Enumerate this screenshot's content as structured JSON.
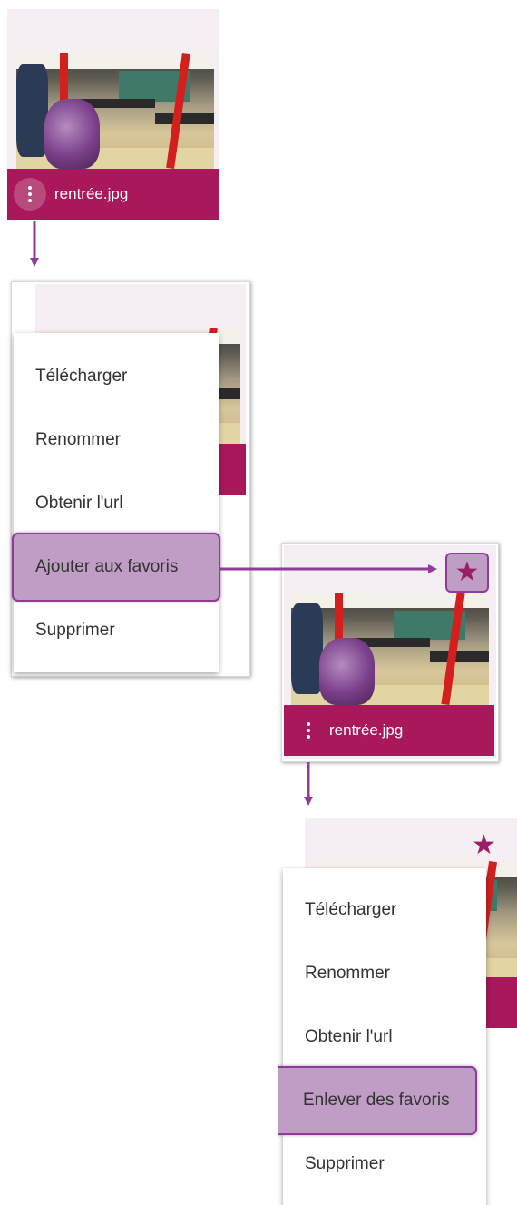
{
  "file": {
    "name": "rentrée.jpg"
  },
  "menu_add": {
    "items": [
      "Télécharger",
      "Renommer",
      "Obtenir l'url",
      "Ajouter aux favoris",
      "Supprimer"
    ],
    "highlighted_index": 3
  },
  "menu_remove": {
    "items": [
      "Télécharger",
      "Renommer",
      "Obtenir l'url",
      "Enlever des favoris",
      "Supprimer"
    ],
    "highlighted_index": 3
  },
  "icons": {
    "more": "more-vertical-icon",
    "favorite": "star-icon",
    "photo": "image-thumbnail"
  },
  "colors": {
    "accent": "#a8185a",
    "highlight_fill": "#bf9dc4",
    "highlight_border": "#8e3c95",
    "arrow": "#8e3c95",
    "star": "#9a1e63"
  }
}
